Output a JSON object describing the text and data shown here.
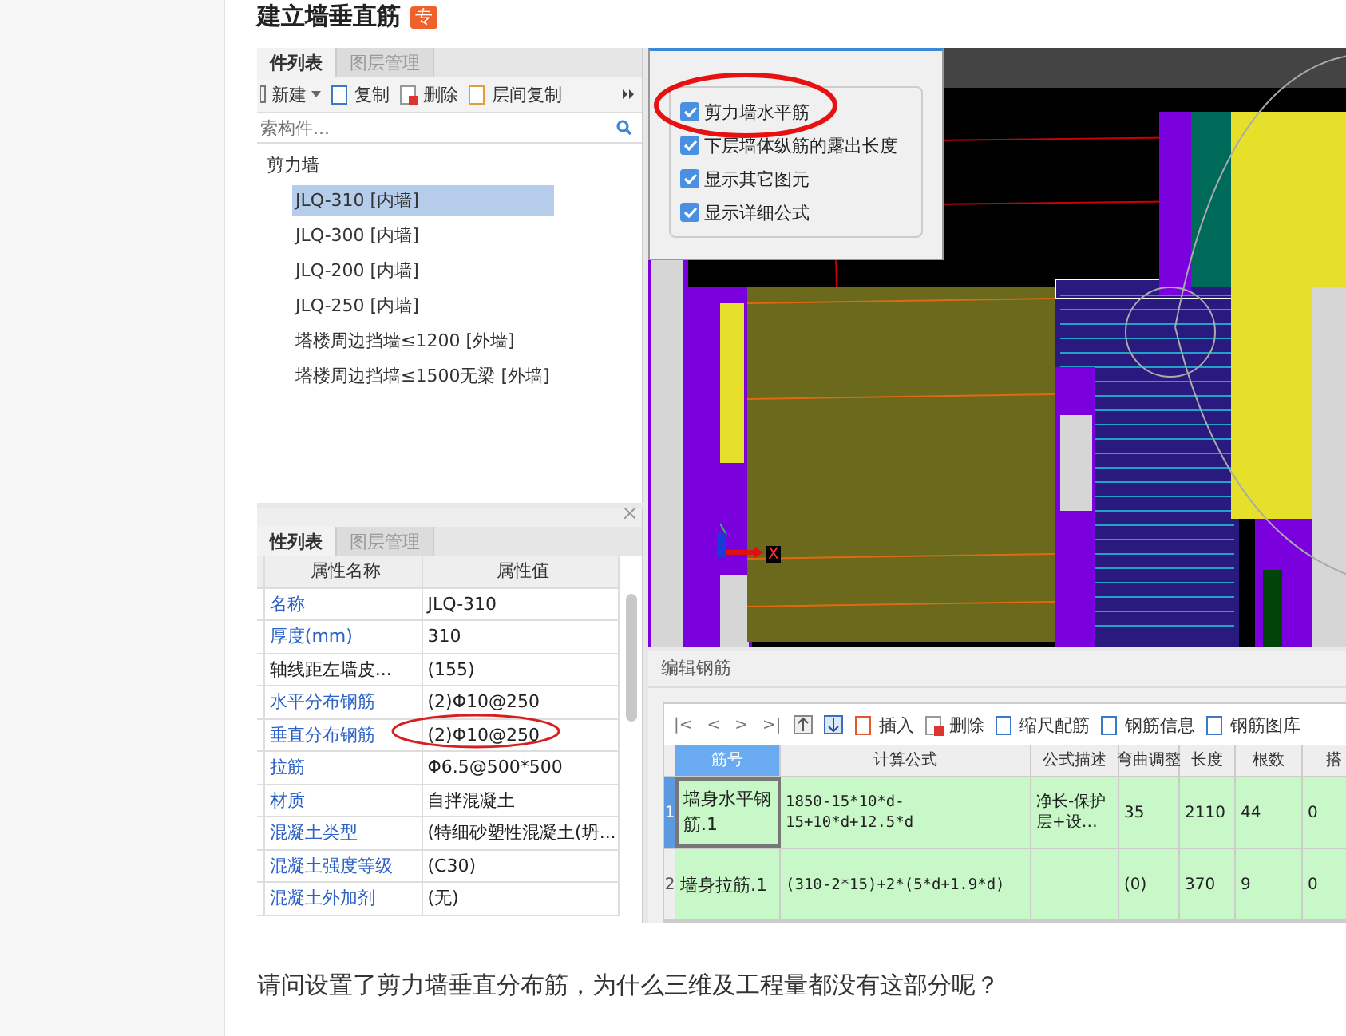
{
  "post": {
    "title": "建立墙垂直筋",
    "badge": "专",
    "question": "请问设置了剪力墙垂直分布筋，为什么三维及工程量都没有这部分呢？"
  },
  "component_panel": {
    "tabs": [
      {
        "label": "件列表",
        "selected": true
      },
      {
        "label": "图层管理",
        "selected": false
      }
    ],
    "toolbar": [
      {
        "kind": "new",
        "label": "新建"
      },
      {
        "kind": "copy",
        "label": "复制"
      },
      {
        "kind": "delete",
        "label": "删除"
      },
      {
        "kind": "floor-copy",
        "label": "层间复制"
      }
    ],
    "search": {
      "placeholder": "索构件..."
    },
    "tree": [
      {
        "label": "剪力墙",
        "selected": false,
        "children": [
          {
            "label": "JLQ-310 [内墙]",
            "selected": true
          },
          {
            "label": "JLQ-300 [内墙]",
            "selected": false
          },
          {
            "label": "JLQ-200 [内墙]",
            "selected": false
          },
          {
            "label": "JLQ-250 [内墙]",
            "selected": false
          },
          {
            "label": "塔楼周边挡墙≤1200 [外墙]",
            "selected": false
          },
          {
            "label": "塔楼周边挡墙≤1500无梁 [外墙]",
            "selected": false
          }
        ]
      }
    ]
  },
  "property_panel": {
    "tabs": [
      {
        "label": "性列表",
        "selected": true
      },
      {
        "label": "图层管理",
        "selected": false
      }
    ],
    "columns": [
      "属性名称",
      "属性值"
    ],
    "rows": [
      {
        "name": "名称",
        "value": "JLQ-310",
        "public": true
      },
      {
        "name": "厚度(mm)",
        "value": "310",
        "public": true
      },
      {
        "name": "轴线距左墙皮...",
        "value": "(155)",
        "public": false
      },
      {
        "name": "水平分布钢筋",
        "value": "(2)Φ10@250",
        "public": true
      },
      {
        "name": "垂直分布钢筋",
        "value": "(2)Φ10@250",
        "public": true
      },
      {
        "name": "拉筋",
        "value": "Φ6.5@500*500",
        "public": true
      },
      {
        "name": "材质",
        "value": "自拌混凝土",
        "public": true
      },
      {
        "name": "混凝土类型",
        "value": "(特细砂塑性混凝土(坍...",
        "public": true
      },
      {
        "name": "混凝土强度等级",
        "value": "(C30)",
        "public": true
      },
      {
        "name": "混凝土外加剂",
        "value": "(无)",
        "public": true
      }
    ]
  },
  "axis_label": "X",
  "view_options": [
    {
      "label": "剪力墙水平筋",
      "checked": true
    },
    {
      "label": "下层墙体纵筋的露出长度",
      "checked": true
    },
    {
      "label": "显示其它图元",
      "checked": true
    },
    {
      "label": "显示详细公式",
      "checked": true
    }
  ],
  "rebar_editor": {
    "title": "编辑钢筋",
    "nav": [
      "|<",
      "<",
      ">",
      ">|"
    ],
    "toolbar": [
      {
        "kind": "insert",
        "label": "插入"
      },
      {
        "kind": "delete",
        "label": "删除"
      },
      {
        "kind": "scale",
        "label": "缩尺配筋"
      },
      {
        "kind": "info",
        "label": "钢筋信息"
      },
      {
        "kind": "library",
        "label": "钢筋图库"
      }
    ],
    "columns": [
      "筋号",
      "计算公式",
      "公式描述",
      "弯曲调整",
      "长度",
      "根数",
      "搭"
    ],
    "rows": [
      {
        "number": "1",
        "selected": true,
        "cells": [
          "墙身水平钢筋.1",
          "1850-15*10*d-15+10*d+12.5*d",
          "净长-保护层+设…",
          "35",
          "2110",
          "44",
          "0"
        ]
      },
      {
        "number": "2",
        "selected": false,
        "cells": [
          "墙身拉筋.1",
          "(310-2*15)+2*(5*d+1.9*d)",
          "",
          "(0)",
          "370",
          "9",
          "0"
        ]
      }
    ]
  }
}
